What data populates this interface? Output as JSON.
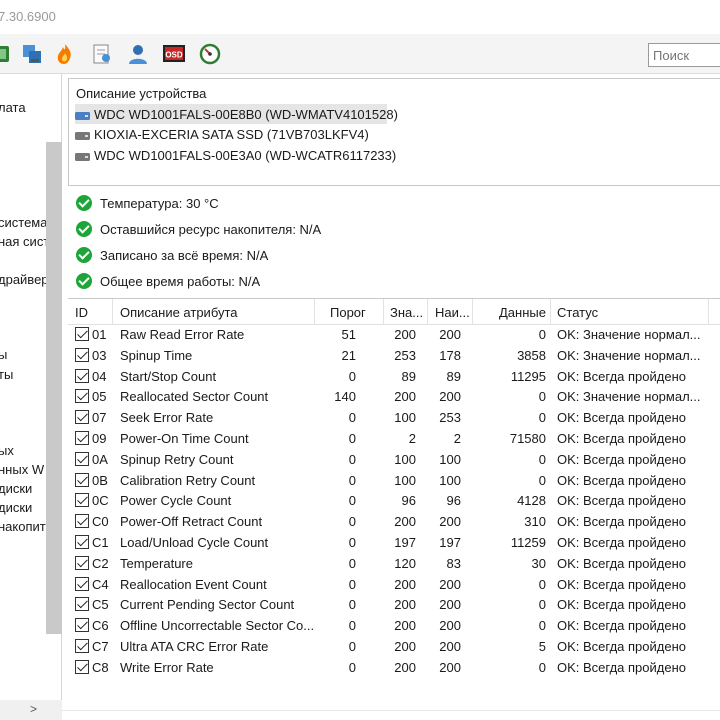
{
  "window": {
    "title": "7.30.6900"
  },
  "toolbar": {
    "buttons": [
      "disk-icon",
      "network-icon",
      "flame-icon",
      "report-icon",
      "user-icon",
      "osd-icon",
      "gauge-icon"
    ],
    "osd_label": "OSD",
    "search_placeholder": "Поиск"
  },
  "sidebar": {
    "items": [
      "лата",
      "система",
      "ная сист",
      "драйвер",
      "ы",
      "ты",
      "ых",
      "нных W",
      "диски",
      "диски",
      "накопит"
    ]
  },
  "devices": {
    "header": "Описание устройства",
    "items": [
      "WDC WD1001FALS-00E8B0 (WD-WMATV4101528)",
      "KIOXIA-EXCERIA SATA SSD (71VB703LKFV4)",
      "WDC WD1001FALS-00E3A0 (WD-WCATR6117233)"
    ]
  },
  "status": {
    "items": [
      "Температура: 30 °C",
      "Оставшийся ресурс накопителя: N/A",
      "Записано за всё время: N/A",
      "Общее время работы: N/A"
    ]
  },
  "smart": {
    "headers": [
      "ID",
      "Описание атрибута",
      "Порог",
      "Зна...",
      "Наи...",
      "Данные",
      "Статус"
    ],
    "rows": [
      {
        "id": "01",
        "name": "Raw Read Error Rate",
        "threshold": "51",
        "value": "200",
        "worst": "200",
        "data": "0",
        "status": "OK: Значение нормал..."
      },
      {
        "id": "03",
        "name": "Spinup Time",
        "threshold": "21",
        "value": "253",
        "worst": "178",
        "data": "3858",
        "status": "OK: Значение нормал..."
      },
      {
        "id": "04",
        "name": "Start/Stop Count",
        "threshold": "0",
        "value": "89",
        "worst": "89",
        "data": "11295",
        "status": "OK: Всегда пройдено"
      },
      {
        "id": "05",
        "name": "Reallocated Sector Count",
        "threshold": "140",
        "value": "200",
        "worst": "200",
        "data": "0",
        "status": "OK: Значение нормал..."
      },
      {
        "id": "07",
        "name": "Seek Error Rate",
        "threshold": "0",
        "value": "100",
        "worst": "253",
        "data": "0",
        "status": "OK: Всегда пройдено"
      },
      {
        "id": "09",
        "name": "Power-On Time Count",
        "threshold": "0",
        "value": "2",
        "worst": "2",
        "data": "71580",
        "status": "OK: Всегда пройдено"
      },
      {
        "id": "0A",
        "name": "Spinup Retry Count",
        "threshold": "0",
        "value": "100",
        "worst": "100",
        "data": "0",
        "status": "OK: Всегда пройдено"
      },
      {
        "id": "0B",
        "name": "Calibration Retry Count",
        "threshold": "0",
        "value": "100",
        "worst": "100",
        "data": "0",
        "status": "OK: Всегда пройдено"
      },
      {
        "id": "0C",
        "name": "Power Cycle Count",
        "threshold": "0",
        "value": "96",
        "worst": "96",
        "data": "4128",
        "status": "OK: Всегда пройдено"
      },
      {
        "id": "C0",
        "name": "Power-Off Retract Count",
        "threshold": "0",
        "value": "200",
        "worst": "200",
        "data": "310",
        "status": "OK: Всегда пройдено"
      },
      {
        "id": "C1",
        "name": "Load/Unload Cycle Count",
        "threshold": "0",
        "value": "197",
        "worst": "197",
        "data": "11259",
        "status": "OK: Всегда пройдено"
      },
      {
        "id": "C2",
        "name": "Temperature",
        "threshold": "0",
        "value": "120",
        "worst": "83",
        "data": "30",
        "status": "OK: Всегда пройдено"
      },
      {
        "id": "C4",
        "name": "Reallocation Event Count",
        "threshold": "0",
        "value": "200",
        "worst": "200",
        "data": "0",
        "status": "OK: Всегда пройдено"
      },
      {
        "id": "C5",
        "name": "Current Pending Sector Count",
        "threshold": "0",
        "value": "200",
        "worst": "200",
        "data": "0",
        "status": "OK: Всегда пройдено"
      },
      {
        "id": "C6",
        "name": "Offline Uncorrectable Sector Co...",
        "threshold": "0",
        "value": "200",
        "worst": "200",
        "data": "0",
        "status": "OK: Всегда пройдено"
      },
      {
        "id": "C7",
        "name": "Ultra ATA CRC Error Rate",
        "threshold": "0",
        "value": "200",
        "worst": "200",
        "data": "5",
        "status": "OK: Всегда пройдено"
      },
      {
        "id": "C8",
        "name": "Write Error Rate",
        "threshold": "0",
        "value": "200",
        "worst": "200",
        "data": "0",
        "status": "OK: Всегда пройдено"
      }
    ]
  },
  "colors": {
    "ok": "#1fa43a",
    "selection": "#e5e5e5",
    "accent": "#0078d7"
  }
}
